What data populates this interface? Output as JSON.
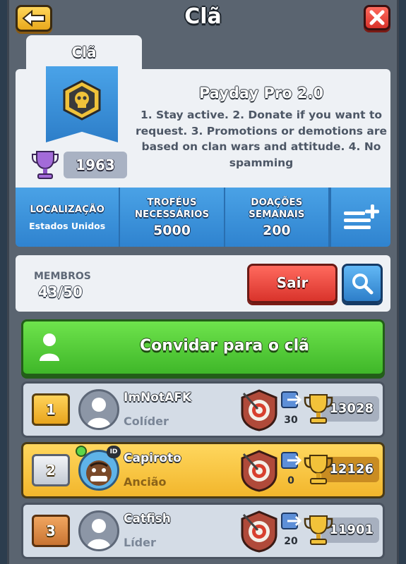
{
  "header": {
    "title": "Clã",
    "back_icon": "arrow-left-icon",
    "close_icon": "close-icon"
  },
  "tab": {
    "label": "Clã"
  },
  "clan": {
    "name": "Payday Pro 2.0",
    "description": "1. Stay active. 2. Donate if you want to request. 3. Promotions or demotions are based on clan wars and attitude. 4. No spamming",
    "trophies": "1963",
    "badge_icon": "skull-badge-icon"
  },
  "stats": {
    "location_label": "LOCALIZAÇÃO",
    "location_value": "Estados Unidos",
    "trophies_label_1": "TROFÉUS",
    "trophies_label_2": "NECESSÁRIOS",
    "trophies_value": "5000",
    "donations_label_1": "DOAÇÕES",
    "donations_label_2": "SEMANAIS",
    "donations_value": "200",
    "menu_icon": "list-add-icon"
  },
  "members": {
    "label": "MEMBROS",
    "count": "43/50",
    "leave_label": "Sair",
    "search_icon": "search-icon"
  },
  "invite": {
    "label": "Convidar para o clã"
  },
  "member_list": [
    {
      "rank": "1",
      "name": "ImNotAFK",
      "role": "Colíder",
      "donations": "30",
      "trophies": "13028"
    },
    {
      "rank": "2",
      "name": "Capiroto",
      "role": "Ancião",
      "donations": "0",
      "trophies": "12126",
      "id_badge": "ID"
    },
    {
      "rank": "3",
      "name": "Catfish",
      "role": "Líder",
      "donations": "20",
      "trophies": "11901"
    }
  ],
  "colors": {
    "accent_blue": "#2f83cf",
    "leave_red": "#d9332b",
    "invite_green": "#3fb729",
    "highlight_gold": "#f2b62c"
  }
}
